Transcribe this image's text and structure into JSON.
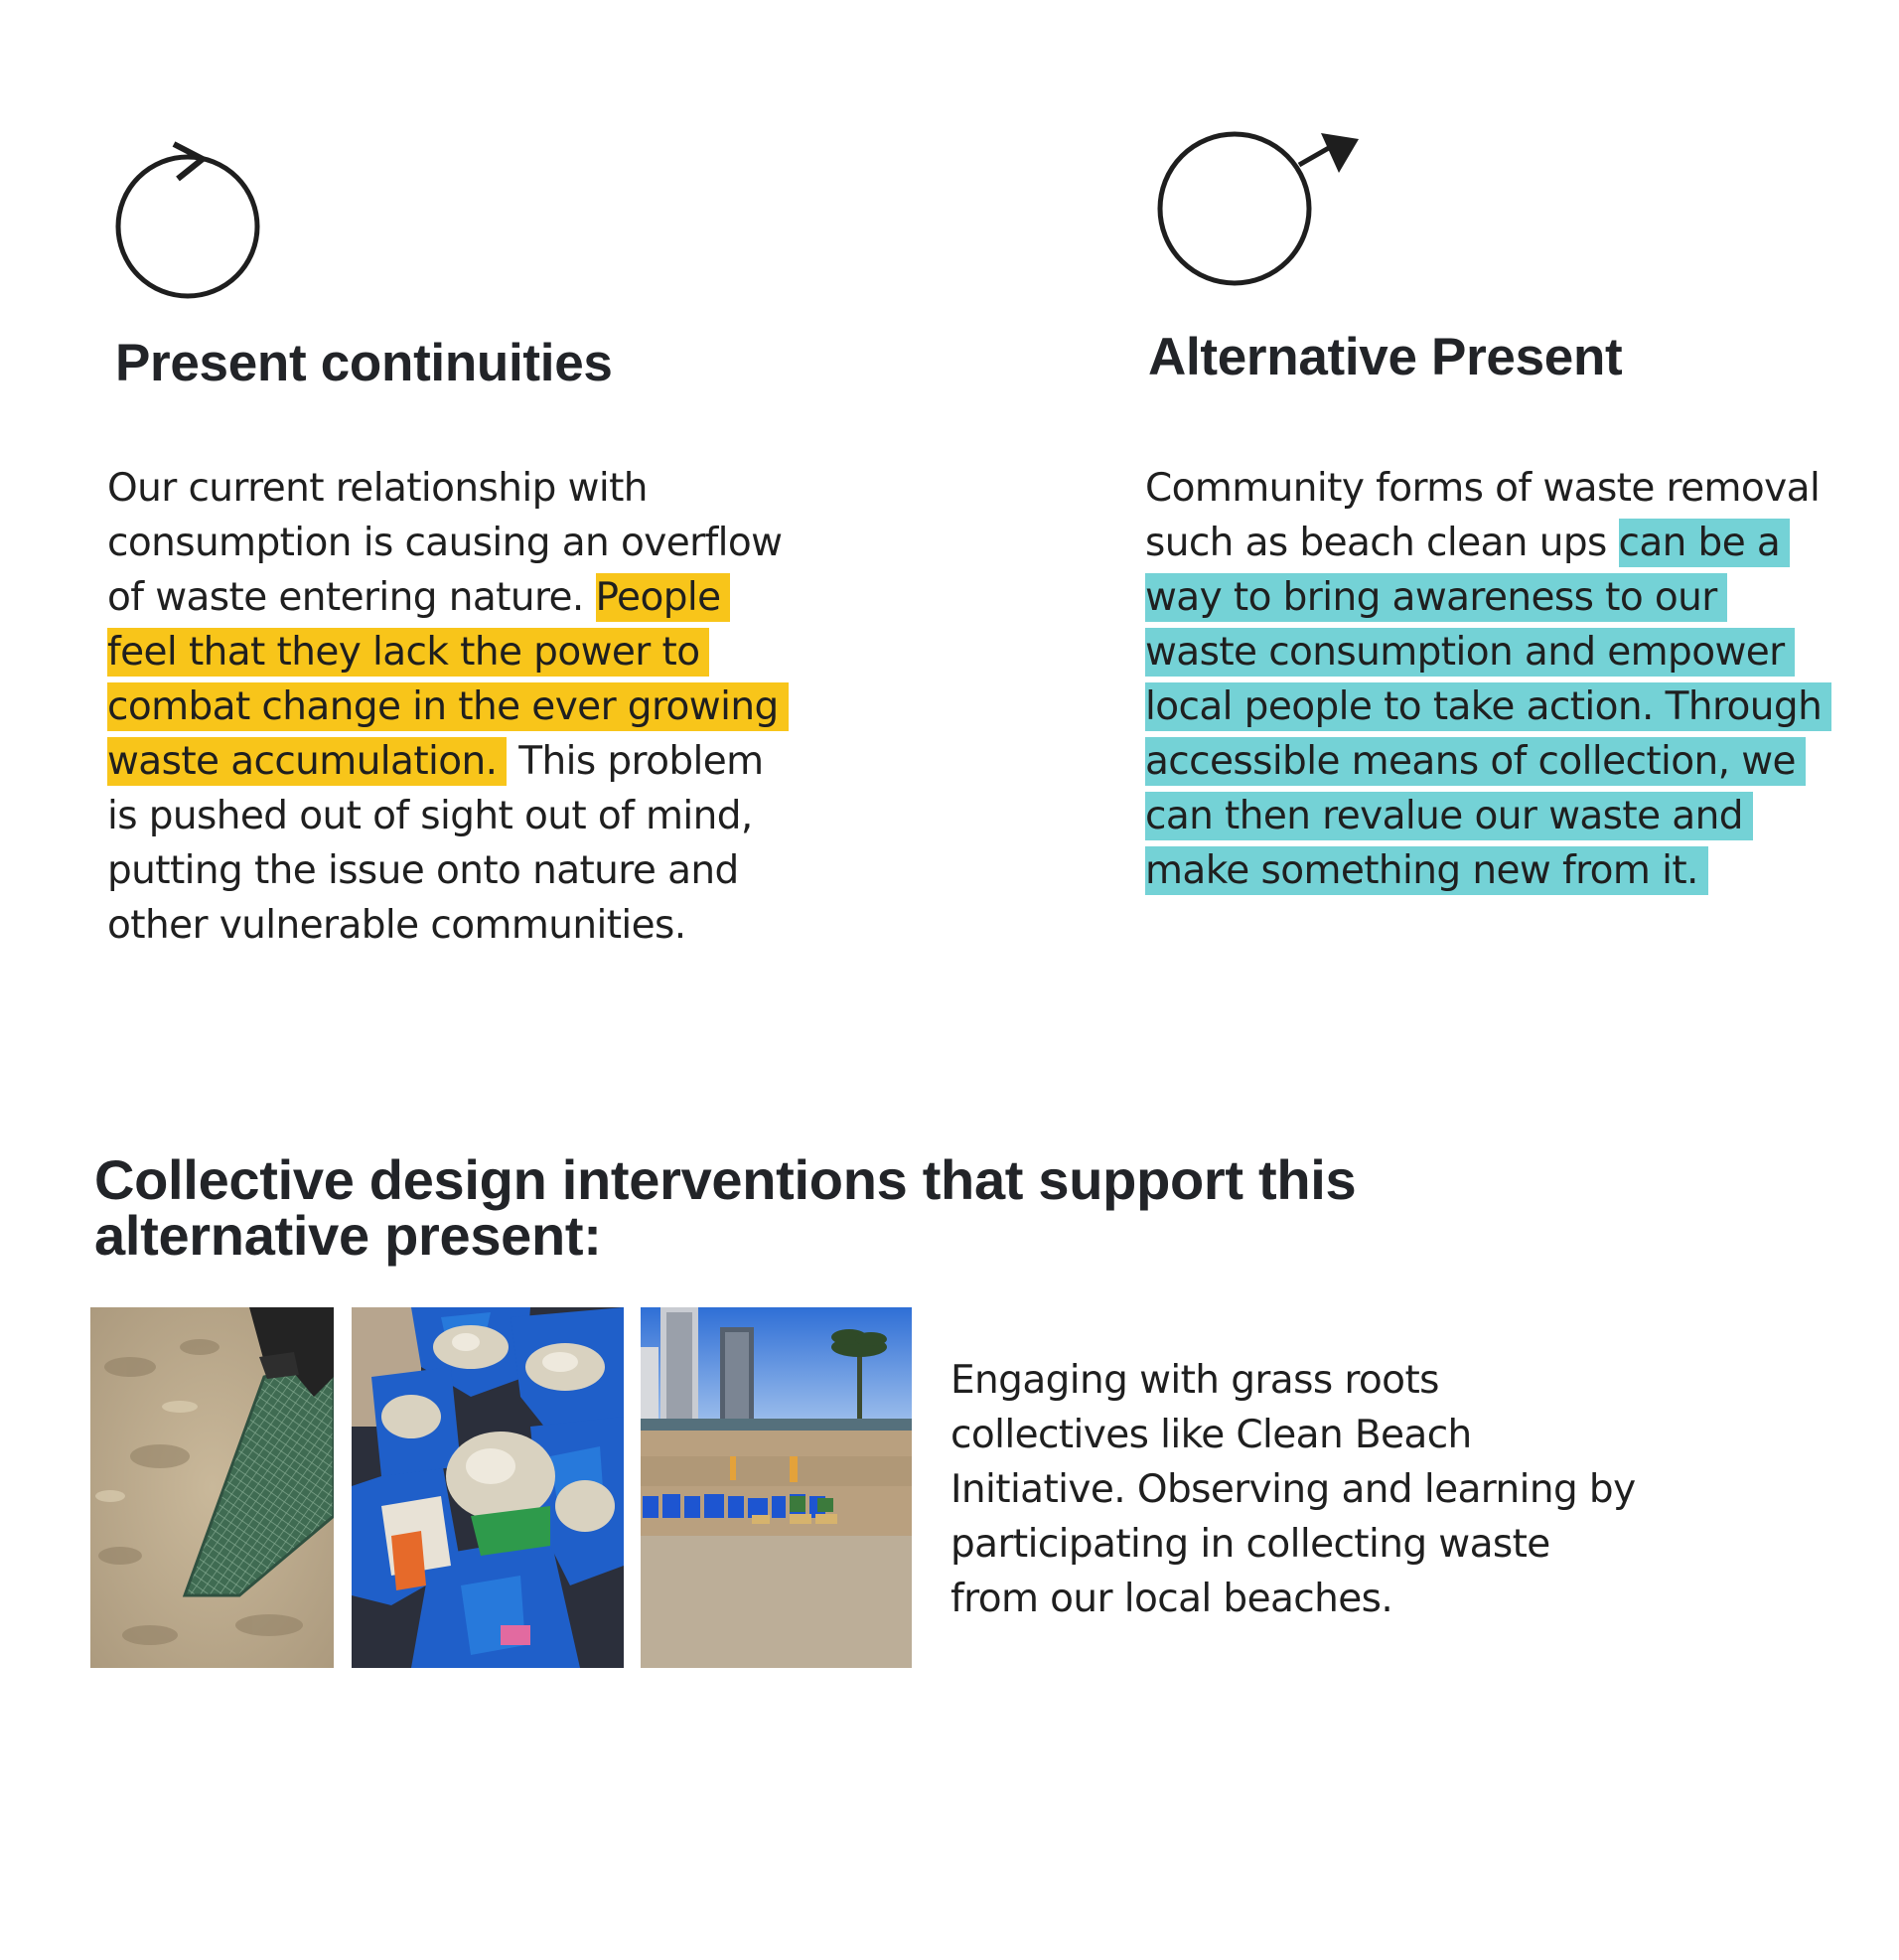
{
  "left_column": {
    "icon": "circular-arrow-icon",
    "title": "Present continuities",
    "paragraph": {
      "line1": "Our current relationship with",
      "line2": "consumption is causing an overflow",
      "line3_plain": "of waste entering nature. ",
      "line3_highlight": "People",
      "line4_highlight": "feel that they lack the power to",
      "line5_highlight": "combat change in the ever growing",
      "line6_highlight": "waste accumulation.",
      "line6_plain": " This problem",
      "line7": "is pushed out of sight out of mind,",
      "line8": "putting the issue onto nature and",
      "line9": "other vulnerable communities."
    },
    "highlight_color": "#f8c51a"
  },
  "right_column": {
    "icon": "circle-outward-arrow-icon",
    "title": "Alternative Present",
    "paragraph": {
      "line1": "Community forms of waste removal",
      "line2_plain": "such as beach clean ups ",
      "line2_highlight": "can be a",
      "line3_highlight": "way to bring awareness to our",
      "line4_highlight": "waste consumption and empower",
      "line5_highlight": "local people to take action. Through",
      "line6_highlight": "accessible means of collection, we",
      "line7_highlight": "can then revalue our waste and",
      "line8_highlight": "make something new from it."
    },
    "highlight_color": "#74d2d6"
  },
  "section": {
    "title_line1": "Collective design interventions that support this",
    "title_line2": "alternative present:",
    "photos": [
      {
        "name": "beach-sand-net-photo"
      },
      {
        "name": "blue-bags-waste-photo"
      },
      {
        "name": "beach-collection-bags-photo"
      }
    ],
    "caption": {
      "line1": "Engaging with grass roots",
      "line2": "collectives like Clean Beach",
      "line3": "Initiative. Observing and learning by",
      "line4": "participating in collecting waste",
      "line5": "from our local beaches."
    }
  }
}
